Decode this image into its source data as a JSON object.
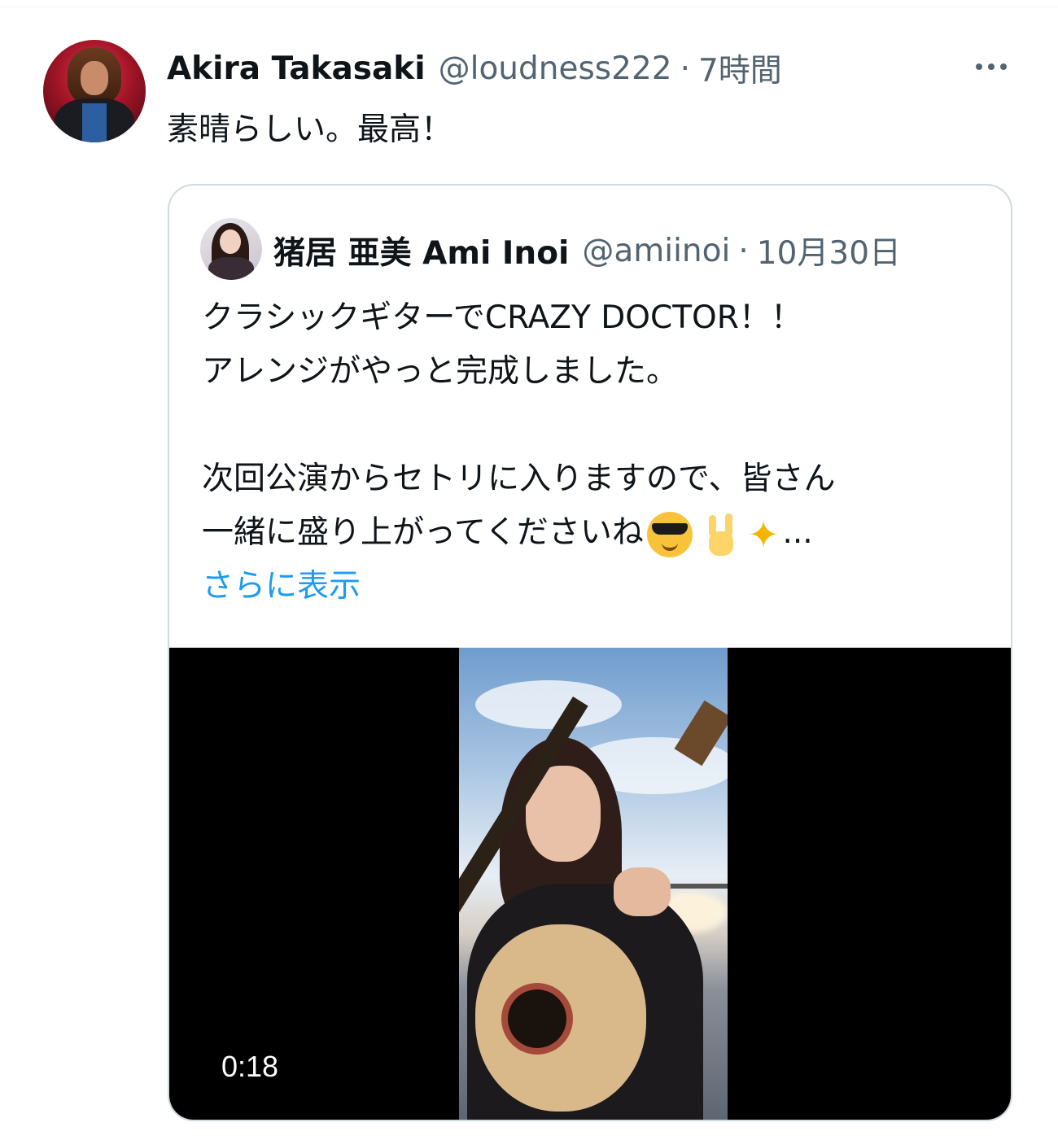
{
  "tweet": {
    "display_name": "Akira Takasaki",
    "handle": "@loudness222",
    "separator": "·",
    "time": "7時間",
    "text": "素晴らしい。最高！",
    "more_icon": "more-horizontal-icon"
  },
  "quote": {
    "display_name": "猪居 亜美 Ami Inoi",
    "handle": "@amiinoi",
    "separator": "·",
    "date": "10月30日",
    "lines": [
      "クラシックギターでCRAZY DOCTOR！！",
      "アレンジがやっと完成しました。",
      "",
      "次回公演からセトリに入りますので、皆さん",
      "一緒に盛り上がってくださいね"
    ],
    "ellipsis": "...",
    "emojis": [
      "smiling-face-with-sunglasses",
      "sign-of-the-horns",
      "sparkles"
    ],
    "show_more": "さらに表示",
    "video": {
      "duration": "0:18"
    }
  },
  "colors": {
    "text": "#0f1419",
    "secondary": "#536471",
    "link": "#1d9bf0",
    "border": "#cfd9de"
  }
}
